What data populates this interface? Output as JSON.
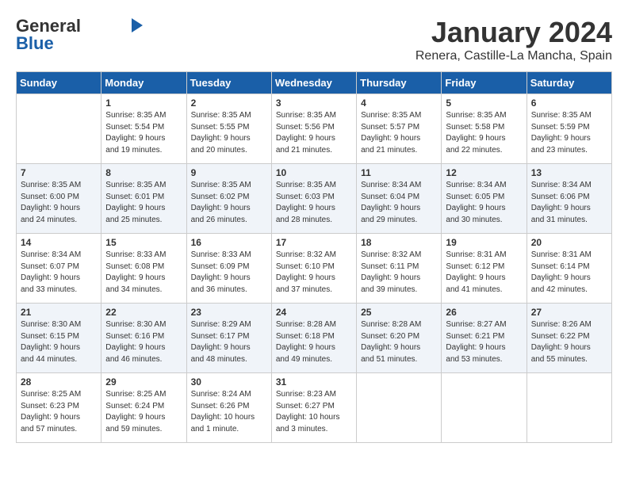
{
  "header": {
    "logo_general": "General",
    "logo_blue": "Blue",
    "month": "January 2024",
    "location": "Renera, Castille-La Mancha, Spain"
  },
  "days_of_week": [
    "Sunday",
    "Monday",
    "Tuesday",
    "Wednesday",
    "Thursday",
    "Friday",
    "Saturday"
  ],
  "weeks": [
    [
      {
        "day": "",
        "info": ""
      },
      {
        "day": "1",
        "info": "Sunrise: 8:35 AM\nSunset: 5:54 PM\nDaylight: 9 hours\nand 19 minutes."
      },
      {
        "day": "2",
        "info": "Sunrise: 8:35 AM\nSunset: 5:55 PM\nDaylight: 9 hours\nand 20 minutes."
      },
      {
        "day": "3",
        "info": "Sunrise: 8:35 AM\nSunset: 5:56 PM\nDaylight: 9 hours\nand 21 minutes."
      },
      {
        "day": "4",
        "info": "Sunrise: 8:35 AM\nSunset: 5:57 PM\nDaylight: 9 hours\nand 21 minutes."
      },
      {
        "day": "5",
        "info": "Sunrise: 8:35 AM\nSunset: 5:58 PM\nDaylight: 9 hours\nand 22 minutes."
      },
      {
        "day": "6",
        "info": "Sunrise: 8:35 AM\nSunset: 5:59 PM\nDaylight: 9 hours\nand 23 minutes."
      }
    ],
    [
      {
        "day": "7",
        "info": "Sunrise: 8:35 AM\nSunset: 6:00 PM\nDaylight: 9 hours\nand 24 minutes."
      },
      {
        "day": "8",
        "info": "Sunrise: 8:35 AM\nSunset: 6:01 PM\nDaylight: 9 hours\nand 25 minutes."
      },
      {
        "day": "9",
        "info": "Sunrise: 8:35 AM\nSunset: 6:02 PM\nDaylight: 9 hours\nand 26 minutes."
      },
      {
        "day": "10",
        "info": "Sunrise: 8:35 AM\nSunset: 6:03 PM\nDaylight: 9 hours\nand 28 minutes."
      },
      {
        "day": "11",
        "info": "Sunrise: 8:34 AM\nSunset: 6:04 PM\nDaylight: 9 hours\nand 29 minutes."
      },
      {
        "day": "12",
        "info": "Sunrise: 8:34 AM\nSunset: 6:05 PM\nDaylight: 9 hours\nand 30 minutes."
      },
      {
        "day": "13",
        "info": "Sunrise: 8:34 AM\nSunset: 6:06 PM\nDaylight: 9 hours\nand 31 minutes."
      }
    ],
    [
      {
        "day": "14",
        "info": "Sunrise: 8:34 AM\nSunset: 6:07 PM\nDaylight: 9 hours\nand 33 minutes."
      },
      {
        "day": "15",
        "info": "Sunrise: 8:33 AM\nSunset: 6:08 PM\nDaylight: 9 hours\nand 34 minutes."
      },
      {
        "day": "16",
        "info": "Sunrise: 8:33 AM\nSunset: 6:09 PM\nDaylight: 9 hours\nand 36 minutes."
      },
      {
        "day": "17",
        "info": "Sunrise: 8:32 AM\nSunset: 6:10 PM\nDaylight: 9 hours\nand 37 minutes."
      },
      {
        "day": "18",
        "info": "Sunrise: 8:32 AM\nSunset: 6:11 PM\nDaylight: 9 hours\nand 39 minutes."
      },
      {
        "day": "19",
        "info": "Sunrise: 8:31 AM\nSunset: 6:12 PM\nDaylight: 9 hours\nand 41 minutes."
      },
      {
        "day": "20",
        "info": "Sunrise: 8:31 AM\nSunset: 6:14 PM\nDaylight: 9 hours\nand 42 minutes."
      }
    ],
    [
      {
        "day": "21",
        "info": "Sunrise: 8:30 AM\nSunset: 6:15 PM\nDaylight: 9 hours\nand 44 minutes."
      },
      {
        "day": "22",
        "info": "Sunrise: 8:30 AM\nSunset: 6:16 PM\nDaylight: 9 hours\nand 46 minutes."
      },
      {
        "day": "23",
        "info": "Sunrise: 8:29 AM\nSunset: 6:17 PM\nDaylight: 9 hours\nand 48 minutes."
      },
      {
        "day": "24",
        "info": "Sunrise: 8:28 AM\nSunset: 6:18 PM\nDaylight: 9 hours\nand 49 minutes."
      },
      {
        "day": "25",
        "info": "Sunrise: 8:28 AM\nSunset: 6:20 PM\nDaylight: 9 hours\nand 51 minutes."
      },
      {
        "day": "26",
        "info": "Sunrise: 8:27 AM\nSunset: 6:21 PM\nDaylight: 9 hours\nand 53 minutes."
      },
      {
        "day": "27",
        "info": "Sunrise: 8:26 AM\nSunset: 6:22 PM\nDaylight: 9 hours\nand 55 minutes."
      }
    ],
    [
      {
        "day": "28",
        "info": "Sunrise: 8:25 AM\nSunset: 6:23 PM\nDaylight: 9 hours\nand 57 minutes."
      },
      {
        "day": "29",
        "info": "Sunrise: 8:25 AM\nSunset: 6:24 PM\nDaylight: 9 hours\nand 59 minutes."
      },
      {
        "day": "30",
        "info": "Sunrise: 8:24 AM\nSunset: 6:26 PM\nDaylight: 10 hours\nand 1 minute."
      },
      {
        "day": "31",
        "info": "Sunrise: 8:23 AM\nSunset: 6:27 PM\nDaylight: 10 hours\nand 3 minutes."
      },
      {
        "day": "",
        "info": ""
      },
      {
        "day": "",
        "info": ""
      },
      {
        "day": "",
        "info": ""
      }
    ]
  ]
}
